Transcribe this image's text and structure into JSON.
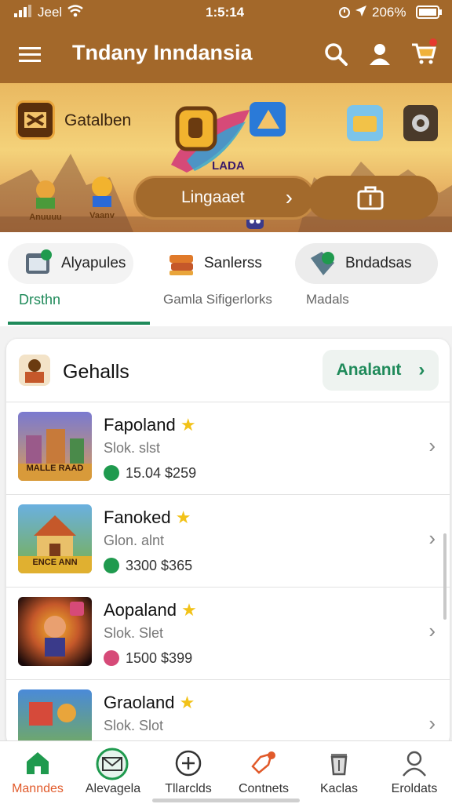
{
  "status": {
    "carrier": "Jeel",
    "time": "1:5:14",
    "battery": "206%"
  },
  "appbar": {
    "title": "Tndany Inndansia"
  },
  "hero": {
    "game_name": "Gatalben",
    "badge_left": "Anuuuu",
    "badge_right": "Vaanv",
    "play_label": "Lingaaet"
  },
  "tabs": [
    {
      "label": "Alyapules",
      "sub": "Drsthn"
    },
    {
      "label": "Sanlerss",
      "sub": "Gamla Sifigerlorks"
    },
    {
      "label": "Bndadsas",
      "sub": "Madals"
    }
  ],
  "section": {
    "title": "Gehalls",
    "see_all": "Analanıt"
  },
  "items": [
    {
      "name": "Fapoland",
      "sub": "Slok. slst",
      "meta": "15.04  $259",
      "thumb_text": "MALLE RAAD",
      "dot_color": "#1f9a4e"
    },
    {
      "name": "Fanoked",
      "sub": "Glon. alnt",
      "meta": "3300  $365",
      "thumb_text": "ENCE ANN",
      "dot_color": "#1f9a4e"
    },
    {
      "name": "Aopaland",
      "sub": "Slok. Slet",
      "meta": "1500  $399",
      "thumb_text": "",
      "dot_color": "#d64a78"
    },
    {
      "name": "Graoland",
      "sub": "Slok. Slot",
      "meta": "",
      "thumb_text": "",
      "dot_color": "#1f9a4e"
    }
  ],
  "nav": [
    {
      "label": "Manndes",
      "icon": "home-icon",
      "active": true
    },
    {
      "label": "Alevagela",
      "icon": "mail-icon",
      "active": false
    },
    {
      "label": "Tllarclds",
      "icon": "plus-circle-icon",
      "active": false
    },
    {
      "label": "Contnets",
      "icon": "megaphone-icon",
      "active": false
    },
    {
      "label": "Kaclas",
      "icon": "trash-icon",
      "active": false
    },
    {
      "label": "Eroldats",
      "icon": "user-icon",
      "active": false
    }
  ],
  "colors": {
    "brand": "#a3682a",
    "accent": "#1f8a5a",
    "star": "#f2c218",
    "active_nav": "#e15a2a"
  }
}
